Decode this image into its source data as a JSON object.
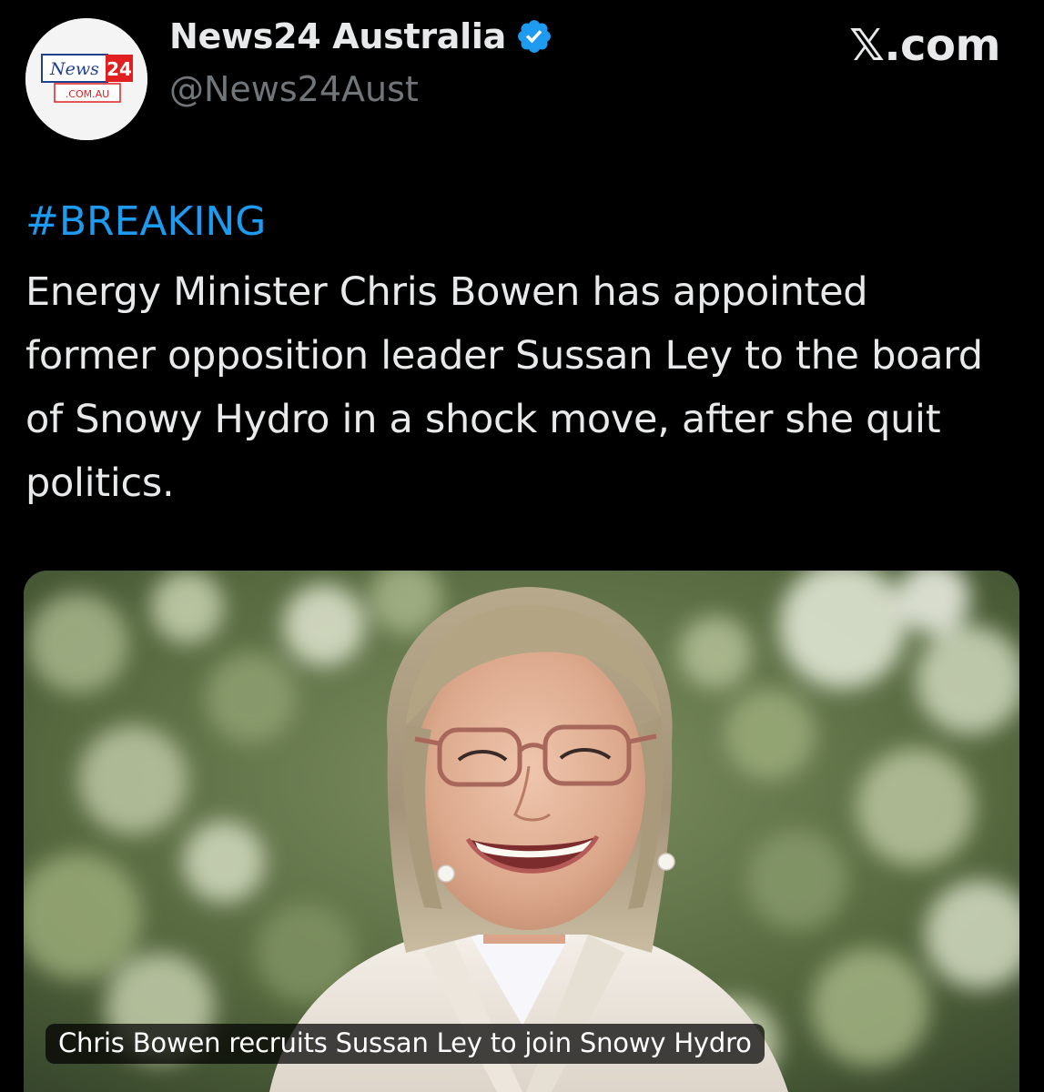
{
  "header": {
    "display_name": "News24 Australia",
    "handle": "@News24Aust",
    "site_label": "𝕏.com",
    "verified": true,
    "avatar": {
      "logo_text": "News24",
      "logo_subtext": ".COM.AU"
    }
  },
  "tweet": {
    "hashtag": "#BREAKING",
    "body": "Energy Minister Chris Bowen has appointed former opposition leader Sussan Ley to the board of Snowy Hydro in a shock move, after she quit politics."
  },
  "media": {
    "caption": "Chris Bowen recruits Sussan Ley to join Snowy Hydro"
  },
  "colors": {
    "background": "#000000",
    "link": "#1d9bf0",
    "verified_badge": "#1d9bf0",
    "secondary_text": "#71767b",
    "primary_text": "#e7e9ea"
  }
}
